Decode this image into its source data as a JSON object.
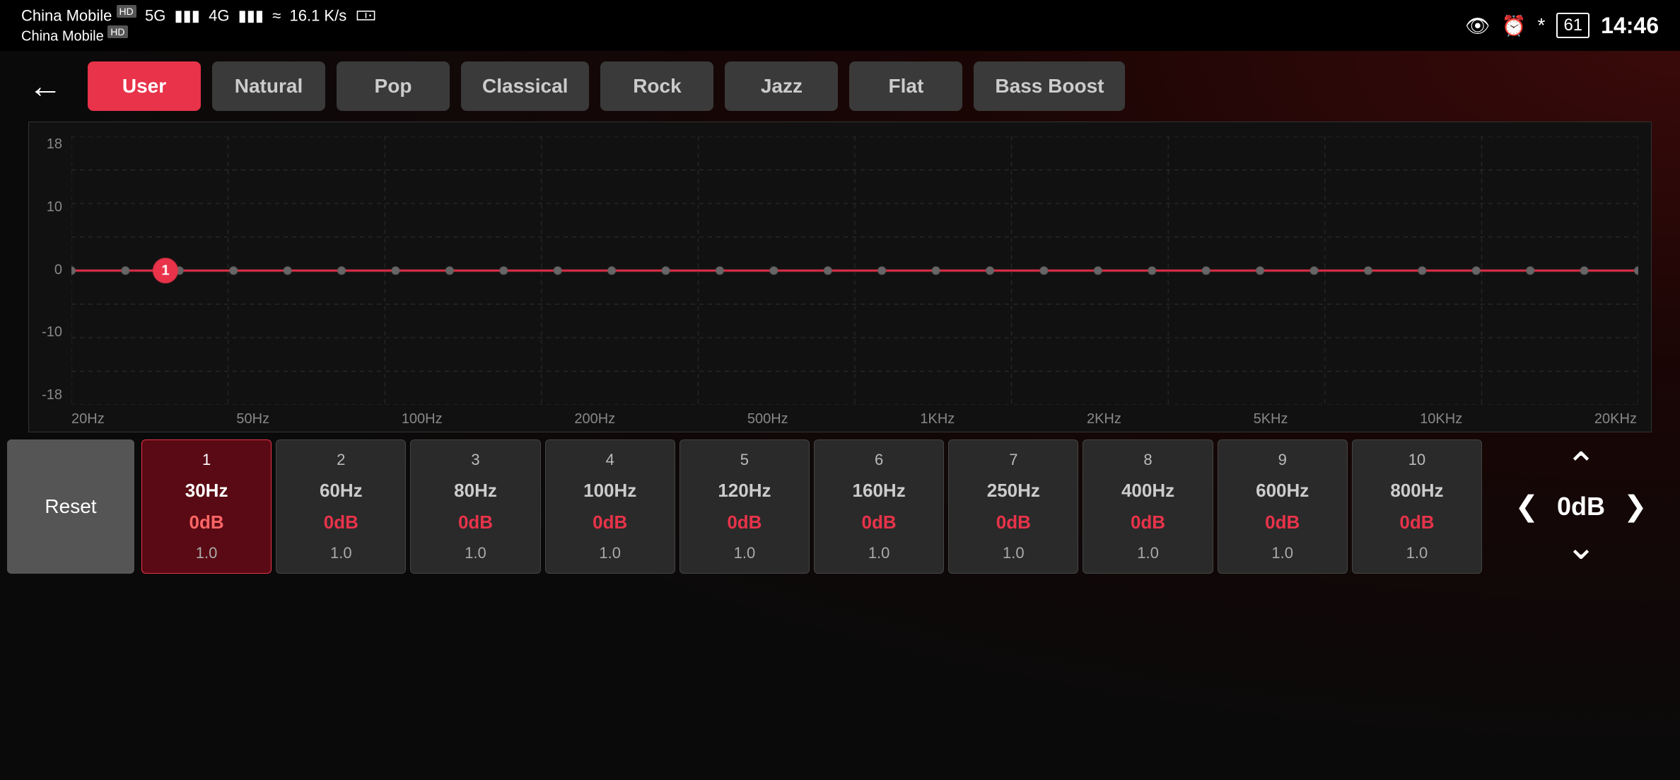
{
  "statusBar": {
    "carrier1": "China Mobile",
    "carrier1_badge": "HD",
    "network": "5G",
    "carrier2": "China Mobile",
    "carrier2_badge": "HD",
    "speed": "16.1 K/s",
    "time": "14:46",
    "battery": "61"
  },
  "header": {
    "back_label": "←",
    "presets": [
      {
        "id": "user",
        "label": "User",
        "active": true
      },
      {
        "id": "natural",
        "label": "Natural",
        "active": false
      },
      {
        "id": "pop",
        "label": "Pop",
        "active": false
      },
      {
        "id": "classical",
        "label": "Classical",
        "active": false
      },
      {
        "id": "rock",
        "label": "Rock",
        "active": false
      },
      {
        "id": "jazz",
        "label": "Jazz",
        "active": false
      },
      {
        "id": "flat",
        "label": "Flat",
        "active": false
      },
      {
        "id": "bass-boost",
        "label": "Bass Boost",
        "active": false
      }
    ]
  },
  "chart": {
    "y_labels": [
      "18",
      "10",
      "0",
      "-10",
      "-18"
    ],
    "x_labels": [
      "20Hz",
      "50Hz",
      "100Hz",
      "200Hz",
      "500Hz",
      "1KHz",
      "2KHz",
      "5KHz",
      "10KHz",
      "20KHz"
    ]
  },
  "bands": [
    {
      "num": "1",
      "freq": "30Hz",
      "db": "0dB",
      "q": "1.0",
      "active": true
    },
    {
      "num": "2",
      "freq": "60Hz",
      "db": "0dB",
      "q": "1.0",
      "active": false
    },
    {
      "num": "3",
      "freq": "80Hz",
      "db": "0dB",
      "q": "1.0",
      "active": false
    },
    {
      "num": "4",
      "freq": "100Hz",
      "db": "0dB",
      "q": "1.0",
      "active": false
    },
    {
      "num": "5",
      "freq": "120Hz",
      "db": "0dB",
      "q": "1.0",
      "active": false
    },
    {
      "num": "6",
      "freq": "160Hz",
      "db": "0dB",
      "q": "1.0",
      "active": false
    },
    {
      "num": "7",
      "freq": "250Hz",
      "db": "0dB",
      "q": "1.0",
      "active": false
    },
    {
      "num": "8",
      "freq": "400Hz",
      "db": "0dB",
      "q": "1.0",
      "active": false
    },
    {
      "num": "9",
      "freq": "600Hz",
      "db": "0dB",
      "q": "1.0",
      "active": false
    },
    {
      "num": "10",
      "freq": "800Hz",
      "db": "0dB",
      "q": "1.0",
      "active": false
    }
  ],
  "controls": {
    "reset_label": "Reset",
    "nav_value": "0dB"
  }
}
